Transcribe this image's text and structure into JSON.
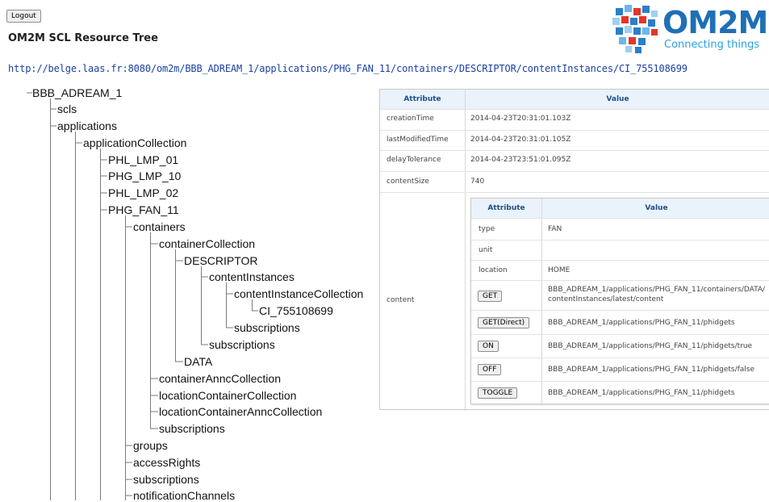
{
  "header": {
    "logout_label": "Logout",
    "title": "OM2M SCL Resource Tree",
    "logo_text": "OM2M",
    "logo_tagline": "Connecting things"
  },
  "url": "http://belge.laas.fr:8080/om2m/BBB_ADREAM_1/applications/PHG_FAN_11/containers/DESCRIPTOR/contentInstances/CI_755108699",
  "tree": {
    "root": "BBB_ADREAM_1",
    "scls": "scls",
    "applications": "applications",
    "applicationCollection": "applicationCollection",
    "phl_lmp_01": "PHL_LMP_01",
    "phg_lmp_10": "PHG_LMP_10",
    "phl_lmp_02": "PHL_LMP_02",
    "phg_fan_11": "PHG_FAN_11",
    "containers": "containers",
    "containerCollection": "containerCollection",
    "descriptor": "DESCRIPTOR",
    "contentInstances": "contentInstances",
    "contentInstanceCollection": "contentInstanceCollection",
    "ci": "CI_755108699",
    "ci_subscriptions": "subscriptions",
    "descriptor_subscriptions": "subscriptions",
    "data": "DATA",
    "containerAnncCollection": "containerAnncCollection",
    "locationContainerCollection": "locationContainerCollection",
    "locationContainerAnncCollection": "locationContainerAnncCollection",
    "containers_subscriptions": "subscriptions",
    "groups": "groups",
    "accessRights": "accessRights",
    "app_subscriptions": "subscriptions",
    "notificationChannels": "notificationChannels"
  },
  "table": {
    "header_attribute": "Attribute",
    "header_value": "Value",
    "rows": [
      {
        "attribute": "creationTime",
        "value": "2014-04-23T20:31:01.103Z"
      },
      {
        "attribute": "lastModifiedTime",
        "value": "2014-04-23T20:31:01.105Z"
      },
      {
        "attribute": "delayTolerance",
        "value": "2014-04-23T23:51:01.095Z"
      },
      {
        "attribute": "contentSize",
        "value": "740"
      }
    ],
    "content_label": "content",
    "content": {
      "header_attribute": "Attribute",
      "header_value": "Value",
      "rows": [
        {
          "attribute": "type",
          "value": "FAN"
        },
        {
          "attribute": "unit",
          "value": ""
        },
        {
          "attribute": "location",
          "value": "HOME"
        }
      ],
      "actions": [
        {
          "button": "GET",
          "value_line1": "BBB_ADREAM_1/applications/PHG_FAN_11/containers/DATA/",
          "value_line2": "contentInstances/latest/content"
        },
        {
          "button": "GET(Direct)",
          "value_line1": "BBB_ADREAM_1/applications/PHG_FAN_11/phidgets",
          "value_line2": ""
        },
        {
          "button": "ON",
          "value_line1": "BBB_ADREAM_1/applications/PHG_FAN_11/phidgets/true",
          "value_line2": ""
        },
        {
          "button": "OFF",
          "value_line1": "BBB_ADREAM_1/applications/PHG_FAN_11/phidgets/false",
          "value_line2": ""
        },
        {
          "button": "TOGGLE",
          "value_line1": "BBB_ADREAM_1/applications/PHG_FAN_11/phidgets",
          "value_line2": ""
        }
      ]
    }
  },
  "colors": {
    "link": "#1a3fa0",
    "table_header_text": "#1f4e8c",
    "table_header_bg": "#eaf2fb",
    "logo_blue": "#1f6fb5",
    "logo_red": "#e2362b"
  }
}
